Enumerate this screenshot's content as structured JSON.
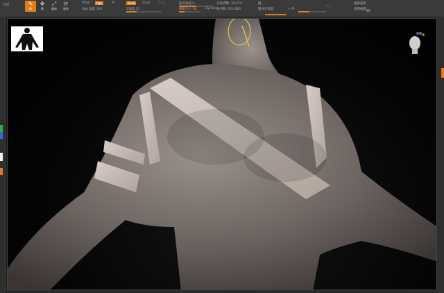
{
  "menu": {
    "first": "行动"
  },
  "toolbar": {
    "tools": [
      {
        "label": "绘",
        "icon": "edit-icon"
      },
      {
        "label": "移",
        "icon": "move-icon"
      },
      {
        "label": "缩放",
        "icon": "scale-icon"
      },
      {
        "label": "旋转",
        "icon": "rotate-icon"
      }
    ]
  },
  "brush": {
    "mrgb": "Mrgb",
    "rgb": "Rgb",
    "m": "M",
    "zadd": "Zadd",
    "zsub": "Zsub",
    "zcut": "Zcut",
    "rgb_intensity": "Rgb 强度 100",
    "z_intensity": "Z强度 25",
    "focal_shift": "焦点衰减 0",
    "draw_size": "绘制大小 38",
    "dynamic": "Dynamic",
    "active_points": "活动点数: 16,474",
    "total_points": "总点数: 953,680",
    "replay": "播",
    "spotlight": "聚光灯投影",
    "mod": "∞ 件",
    "dots": "* *"
  },
  "right_panel": {
    "label1": "搜索投影",
    "label2": "透明抽取"
  },
  "colors": {
    "accent": "#e07c1b",
    "bg": "#2b2b2b"
  }
}
